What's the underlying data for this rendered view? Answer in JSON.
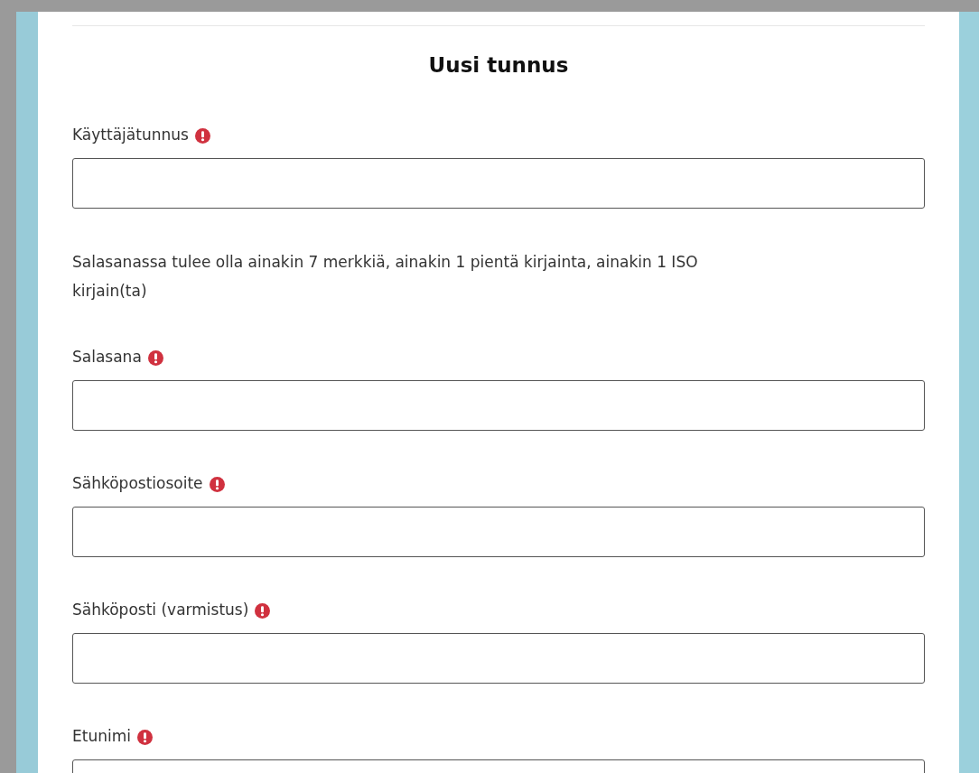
{
  "form": {
    "title": "Uusi tunnus",
    "items": [
      {
        "kind": "field",
        "label": "Käyttäjätunnus",
        "required": true
      },
      {
        "kind": "hint",
        "text": "Salasanassa tulee olla ainakin 7 merkkiä, ainakin 1 pientä kirjainta, ainakin 1 ISO kirjain(ta)"
      },
      {
        "kind": "field",
        "label": "Salasana",
        "required": true
      },
      {
        "kind": "field",
        "label": "Sähköpostiosoite",
        "required": true
      },
      {
        "kind": "field",
        "label": "Sähköposti (varmistus)",
        "required": true
      },
      {
        "kind": "field",
        "label": "Etunimi",
        "required": true
      }
    ]
  }
}
